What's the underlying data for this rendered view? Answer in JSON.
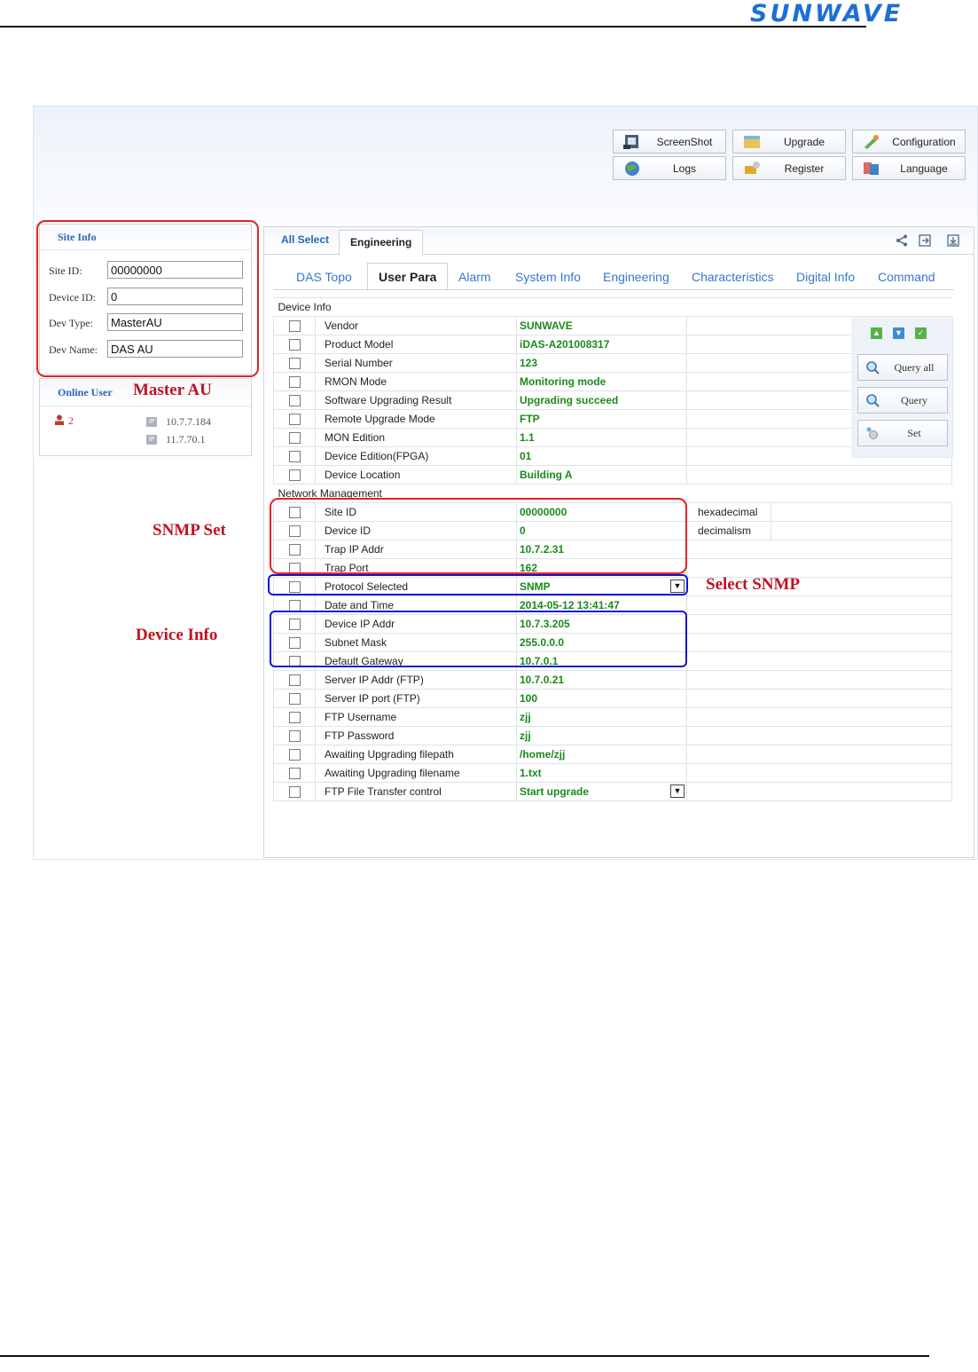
{
  "brand": {
    "logo_text": "SUNWAVE"
  },
  "toolbar": {
    "buttons": [
      {
        "label": "ScreenShot",
        "icon": "screenshot-icon"
      },
      {
        "label": "Upgrade",
        "icon": "upgrade-icon"
      },
      {
        "label": "Configuration",
        "icon": "configuration-icon"
      },
      {
        "label": "Logs",
        "icon": "logs-icon"
      },
      {
        "label": "Register",
        "icon": "register-icon"
      },
      {
        "label": "Language",
        "icon": "language-icon"
      }
    ]
  },
  "site_info": {
    "title": "Site Info",
    "fields": [
      {
        "label": "Site ID:",
        "value": "00000000"
      },
      {
        "label": "Device ID:",
        "value": "0"
      },
      {
        "label": "Dev Type:",
        "value": "MasterAU"
      },
      {
        "label": "Dev Name:",
        "value": "DAS AU"
      }
    ]
  },
  "online_user": {
    "title": "Online User",
    "count": "2",
    "ips": [
      "10.7.7.184",
      "11.7.70.1"
    ]
  },
  "outer_tabs": {
    "all_select": "All Select",
    "engineering": "Engineering"
  },
  "inner_tabs": [
    "DAS Topo",
    "User Para",
    "Alarm",
    "System Info",
    "Engineering",
    "Characteristics",
    "Digital Info",
    "Command"
  ],
  "sections": {
    "device_info": "Device Info",
    "network_management": "Network Management"
  },
  "device_info_rows": [
    {
      "name": "Vendor",
      "value": "SUNWAVE"
    },
    {
      "name": "Product Model",
      "value": "iDAS-A201008317"
    },
    {
      "name": "Serial Number",
      "value": "123"
    },
    {
      "name": "RMON Mode",
      "value": "Monitoring mode"
    },
    {
      "name": "Software Upgrading Result",
      "value": "Upgrading succeed"
    },
    {
      "name": "Remote Upgrade Mode",
      "value": "FTP"
    },
    {
      "name": "MON Edition",
      "value": "1.1"
    },
    {
      "name": "Device Edition(FPGA)",
      "value": "01"
    },
    {
      "name": "Device Location",
      "value": "Building A"
    }
  ],
  "network_rows": [
    {
      "name": "Site ID",
      "value": "00000000",
      "unit": "hexadecimal"
    },
    {
      "name": "Device ID",
      "value": "0",
      "unit": "decimalism"
    },
    {
      "name": "Trap IP Addr",
      "value": "10.7.2.31"
    },
    {
      "name": "Trap Port",
      "value": "162"
    },
    {
      "name": "Protocol Selected",
      "value": "SNMP",
      "dropdown": true
    },
    {
      "name": "Date and Time",
      "value": "2014-05-12 13:41:47"
    },
    {
      "name": "Device IP Addr",
      "value": "10.7.3.205"
    },
    {
      "name": "Subnet Mask",
      "value": "255.0.0.0"
    },
    {
      "name": "Default Gateway",
      "value": "10.7.0.1"
    },
    {
      "name": "Server IP Addr (FTP)",
      "value": "10.7.0.21"
    },
    {
      "name": "Server IP port (FTP)",
      "value": "100"
    },
    {
      "name": "FTP Username",
      "value": "zjj"
    },
    {
      "name": "FTP Password",
      "value": "zjj"
    },
    {
      "name": "Awaiting Upgrading filepath",
      "value": "/home/zjj"
    },
    {
      "name": "Awaiting Upgrading filename",
      "value": "1.txt"
    },
    {
      "name": "FTP File Transfer control",
      "value": "Start upgrade",
      "dropdown": true
    }
  ],
  "actions": {
    "query_all": "Query all",
    "query": "Query",
    "set": "Set"
  },
  "annotations": {
    "master_au": "Master AU",
    "snmp_set": "SNMP Set",
    "select_snmp": "Select SNMP",
    "device_info": "Device Info"
  },
  "colors": {
    "value_green": "#1b8a1b",
    "tab_blue": "#3478c8",
    "annotation_red": "#c1121f",
    "highlight_red": "#e52323",
    "highlight_blue": "#1414d6"
  }
}
